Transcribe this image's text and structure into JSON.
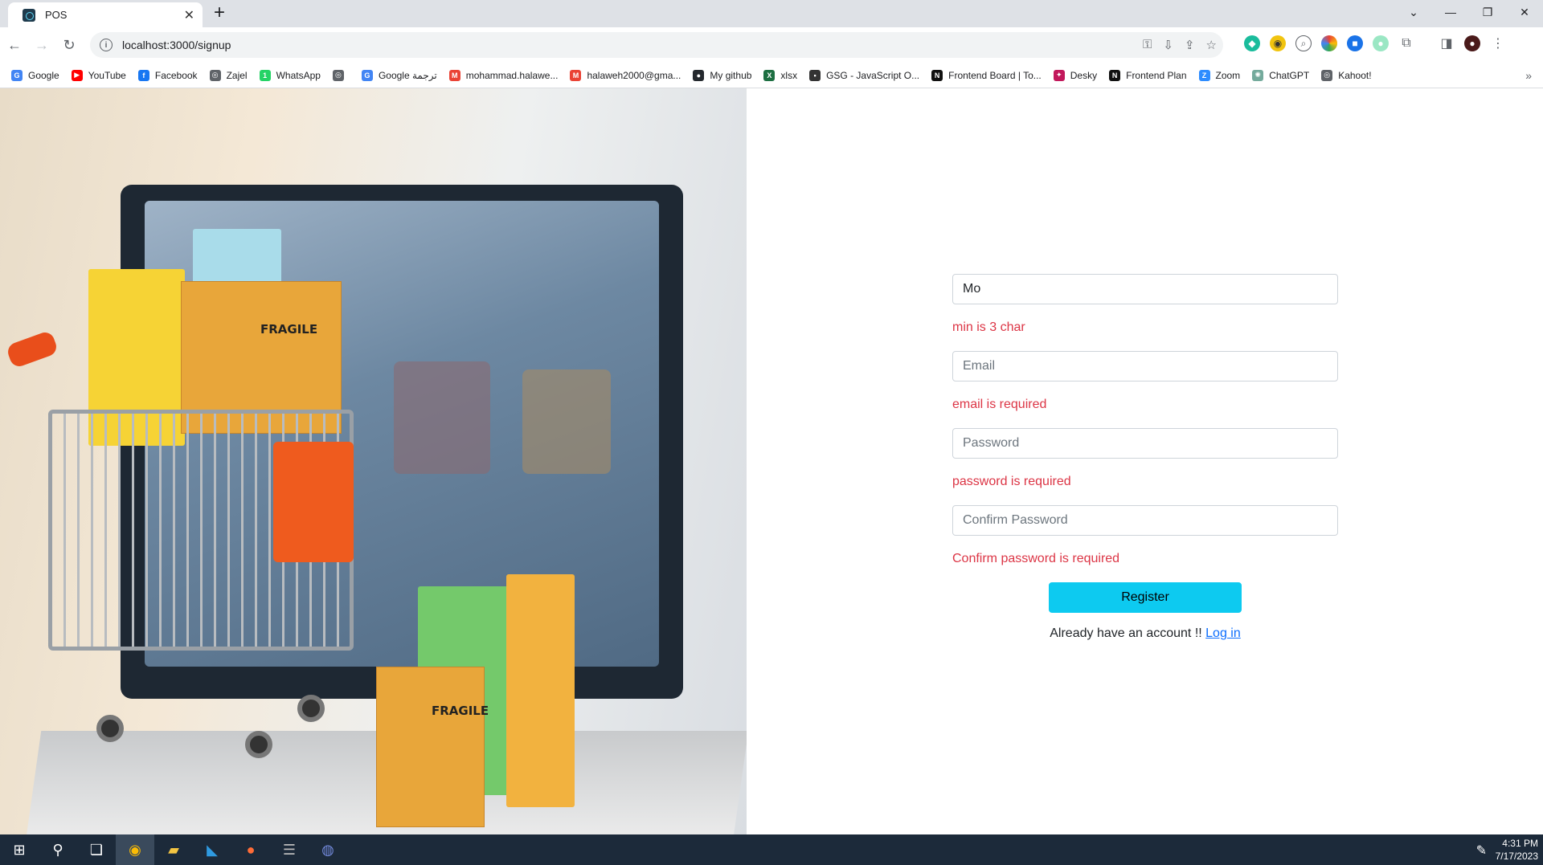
{
  "browser": {
    "tab_title": "POS",
    "url": "localhost:3000/signup",
    "bookmarks": [
      {
        "label": "Google",
        "color": "#4285f4",
        "glyph": "G"
      },
      {
        "label": "YouTube",
        "color": "#ff0000",
        "glyph": "▶"
      },
      {
        "label": "Facebook",
        "color": "#1877f2",
        "glyph": "f"
      },
      {
        "label": "Zajel",
        "color": "#5f6368",
        "glyph": "◎"
      },
      {
        "label": "WhatsApp",
        "color": "#25d366",
        "glyph": "1"
      },
      {
        "label": "",
        "color": "#5f6368",
        "glyph": "◎"
      },
      {
        "label": "Google ترجمة",
        "color": "#4285f4",
        "glyph": "G"
      },
      {
        "label": "mohammad.halawe...",
        "color": "#ea4335",
        "glyph": "M"
      },
      {
        "label": "halaweh2000@gma...",
        "color": "#ea4335",
        "glyph": "M"
      },
      {
        "label": "My github",
        "color": "#24292e",
        "glyph": "●"
      },
      {
        "label": "xlsx",
        "color": "#1d6f42",
        "glyph": "X"
      },
      {
        "label": "GSG - JavaScript O...",
        "color": "#333333",
        "glyph": "▪"
      },
      {
        "label": "Frontend Board | To...",
        "color": "#111111",
        "glyph": "N"
      },
      {
        "label": "Desky",
        "color": "#c2185b",
        "glyph": "✦"
      },
      {
        "label": "Frontend Plan",
        "color": "#111111",
        "glyph": "N"
      },
      {
        "label": "Zoom",
        "color": "#2d8cff",
        "glyph": "Z"
      },
      {
        "label": "ChatGPT",
        "color": "#74aa9c",
        "glyph": "✺"
      },
      {
        "label": "Kahoot!",
        "color": "#5f6368",
        "glyph": "◎"
      }
    ]
  },
  "hero": {
    "box_label_1": "FRAGILE",
    "box_label_2": "FRAGILE"
  },
  "form": {
    "username": {
      "value": "Mo",
      "error": "min is 3 char"
    },
    "email": {
      "placeholder": "Email",
      "error": "email is required"
    },
    "password": {
      "placeholder": "Password",
      "error": "password is required"
    },
    "confirm": {
      "placeholder": "Confirm Password",
      "error": "Confirm password is required"
    },
    "register_label": "Register",
    "login_prompt": "Already have an account !!",
    "login_link": "Log in"
  },
  "taskbar": {
    "time": "4:31 PM",
    "date": "7/17/2023"
  }
}
